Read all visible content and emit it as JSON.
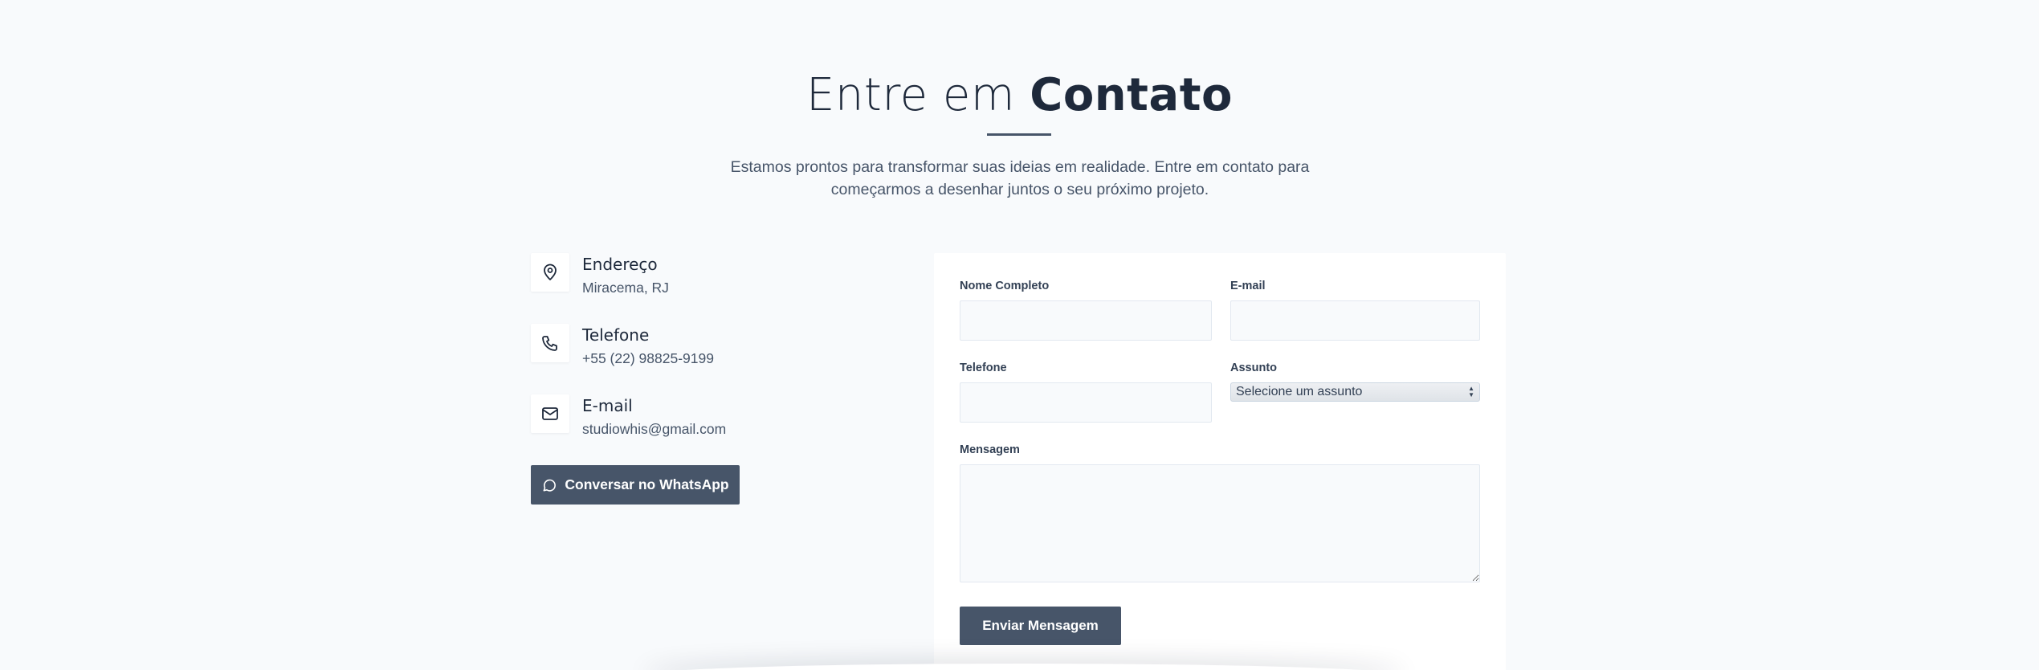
{
  "section": {
    "title_light": "Entre em ",
    "title_bold": "Contato",
    "lead": "Estamos prontos para transformar suas ideias em realidade. Entre em contato para começarmos a desenhar juntos o seu próximo projeto."
  },
  "contact": {
    "items": [
      {
        "icon": "map-pin-icon",
        "title": "Endereço",
        "value": "Miracema, RJ"
      },
      {
        "icon": "phone-icon",
        "title": "Telefone",
        "value": "+55 (22) 98825-9199"
      },
      {
        "icon": "mail-icon",
        "title": "E-mail",
        "value": "studiowhis@gmail.com"
      }
    ],
    "whatsapp_label": "Conversar no WhatsApp",
    "whatsapp_icon": "chat-bubble-icon"
  },
  "form": {
    "name_label": "Nome Completo",
    "name_value": "",
    "email_label": "E-mail",
    "email_value": "",
    "phone_label": "Telefone",
    "phone_value": "",
    "subject_label": "Assunto",
    "subject_selected": "Selecione um assunto",
    "message_label": "Mensagem",
    "message_value": "",
    "submit_label": "Enviar Mensagem"
  },
  "colors": {
    "background": "#f8fafc",
    "heading": "#1e293b",
    "accent": "#475569",
    "card": "#ffffff"
  }
}
